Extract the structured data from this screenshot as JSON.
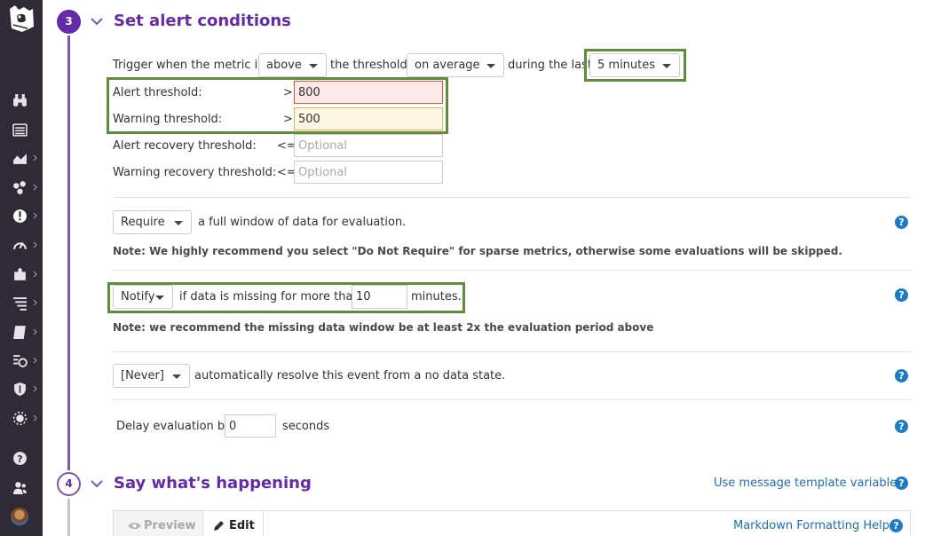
{
  "sidebar": {
    "logo_icon": "datadog-logo-icon",
    "items": [
      {
        "icon": "binoculars-icon",
        "name": "sidebar-item-watchdog"
      },
      {
        "icon": "list-icon",
        "name": "sidebar-item-events"
      },
      {
        "icon": "area-chart-icon",
        "name": "sidebar-item-dashboards"
      },
      {
        "icon": "hexagons-icon",
        "name": "sidebar-item-infrastructure"
      },
      {
        "icon": "alert-icon",
        "name": "sidebar-item-monitors"
      },
      {
        "icon": "gauge-icon",
        "name": "sidebar-item-metrics"
      },
      {
        "icon": "puzzle-icon",
        "name": "sidebar-item-integrations"
      },
      {
        "icon": "filter-lines-icon",
        "name": "sidebar-item-apm"
      },
      {
        "icon": "notebook-icon",
        "name": "sidebar-item-notebooks"
      },
      {
        "icon": "logs-icon",
        "name": "sidebar-item-logs"
      },
      {
        "icon": "shield-icon",
        "name": "sidebar-item-security"
      },
      {
        "icon": "synthetics-icon",
        "name": "sidebar-item-synthetics"
      }
    ],
    "bottom": [
      {
        "icon": "help-icon",
        "name": "sidebar-item-help"
      },
      {
        "icon": "team-icon",
        "name": "sidebar-item-team"
      }
    ]
  },
  "step3": {
    "number": "3",
    "title": "Set alert conditions",
    "trigger": {
      "prefix": "Trigger when the metric is",
      "comparator": "above",
      "mid": "the threshold",
      "aggregation": "on average",
      "during": "during the last",
      "window": "5 minutes"
    },
    "thresholds": [
      {
        "label": "Alert threshold:",
        "op": ">",
        "value": "800",
        "placeholder": ""
      },
      {
        "label": "Warning threshold:",
        "op": ">",
        "value": "500",
        "placeholder": ""
      },
      {
        "label": "Alert recovery threshold:",
        "op": "<=",
        "value": "",
        "placeholder": "Optional"
      },
      {
        "label": "Warning recovery threshold:",
        "op": "<=",
        "value": "",
        "placeholder": "Optional"
      }
    ],
    "require": {
      "select": "Require",
      "text": "a full window of data for evaluation.",
      "note": "Note: We highly recommend you select \"Do Not Require\" for sparse metrics, otherwise some evaluations will be skipped."
    },
    "nodata": {
      "select": "Notify",
      "text": "if data is missing for more than",
      "minutes": "10",
      "unit": "minutes.",
      "note": "Note: we recommend the missing data window be at least 2x the evaluation period above"
    },
    "autoresolve": {
      "select": "[Never]",
      "text": "automatically resolve this event from a no data state."
    },
    "delay": {
      "prefix": "Delay evaluation by",
      "value": "0",
      "unit": "seconds"
    },
    "help_glyph": "?"
  },
  "step4": {
    "number": "4",
    "title": "Say what's happening",
    "template_link": "Use message template variables",
    "tabs": {
      "preview": "Preview",
      "edit": "Edit"
    },
    "markdown_link": "Markdown Formatting Help"
  },
  "colors": {
    "brand_purple": "#632ca6",
    "highlight_green": "#5f8d3a",
    "alert_bg": "#fde8e8",
    "warn_bg": "#fef6e4",
    "link_blue": "#1d6fb8"
  }
}
